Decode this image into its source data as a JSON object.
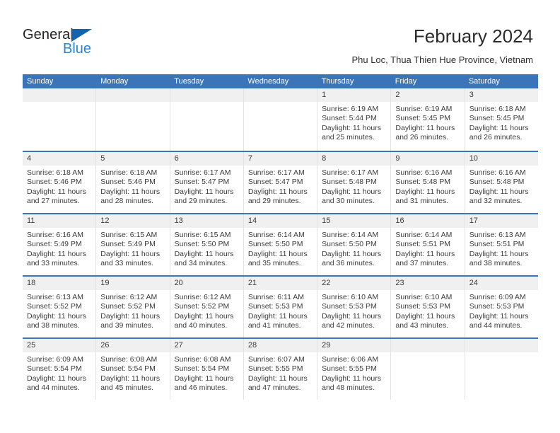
{
  "brand": {
    "name_part1": "General",
    "name_part2": "Blue",
    "triangle_color": "#1562ad",
    "blue_color": "#2786d4"
  },
  "header": {
    "title": "February 2024",
    "subtitle": "Phu Loc, Thua Thien Hue Province, Vietnam"
  },
  "theme": {
    "header_blue": "#3b75b8",
    "row_rule_blue": "#3b75b8",
    "daynum_band": "#f0f0f0",
    "cell_border": "#e2e2e2"
  },
  "calendar": {
    "weekdays": [
      "Sunday",
      "Monday",
      "Tuesday",
      "Wednesday",
      "Thursday",
      "Friday",
      "Saturday"
    ],
    "weeks": [
      [
        {
          "day": "",
          "sunrise": "",
          "sunset": "",
          "daylight": "",
          "empty": true
        },
        {
          "day": "",
          "sunrise": "",
          "sunset": "",
          "daylight": "",
          "empty": true
        },
        {
          "day": "",
          "sunrise": "",
          "sunset": "",
          "daylight": "",
          "empty": true
        },
        {
          "day": "",
          "sunrise": "",
          "sunset": "",
          "daylight": "",
          "empty": true
        },
        {
          "day": "1",
          "sunrise": "Sunrise: 6:19 AM",
          "sunset": "Sunset: 5:44 PM",
          "daylight": "Daylight: 11 hours and 25 minutes."
        },
        {
          "day": "2",
          "sunrise": "Sunrise: 6:19 AM",
          "sunset": "Sunset: 5:45 PM",
          "daylight": "Daylight: 11 hours and 26 minutes."
        },
        {
          "day": "3",
          "sunrise": "Sunrise: 6:18 AM",
          "sunset": "Sunset: 5:45 PM",
          "daylight": "Daylight: 11 hours and 26 minutes."
        }
      ],
      [
        {
          "day": "4",
          "sunrise": "Sunrise: 6:18 AM",
          "sunset": "Sunset: 5:46 PM",
          "daylight": "Daylight: 11 hours and 27 minutes."
        },
        {
          "day": "5",
          "sunrise": "Sunrise: 6:18 AM",
          "sunset": "Sunset: 5:46 PM",
          "daylight": "Daylight: 11 hours and 28 minutes."
        },
        {
          "day": "6",
          "sunrise": "Sunrise: 6:17 AM",
          "sunset": "Sunset: 5:47 PM",
          "daylight": "Daylight: 11 hours and 29 minutes."
        },
        {
          "day": "7",
          "sunrise": "Sunrise: 6:17 AM",
          "sunset": "Sunset: 5:47 PM",
          "daylight": "Daylight: 11 hours and 29 minutes."
        },
        {
          "day": "8",
          "sunrise": "Sunrise: 6:17 AM",
          "sunset": "Sunset: 5:48 PM",
          "daylight": "Daylight: 11 hours and 30 minutes."
        },
        {
          "day": "9",
          "sunrise": "Sunrise: 6:16 AM",
          "sunset": "Sunset: 5:48 PM",
          "daylight": "Daylight: 11 hours and 31 minutes."
        },
        {
          "day": "10",
          "sunrise": "Sunrise: 6:16 AM",
          "sunset": "Sunset: 5:48 PM",
          "daylight": "Daylight: 11 hours and 32 minutes."
        }
      ],
      [
        {
          "day": "11",
          "sunrise": "Sunrise: 6:16 AM",
          "sunset": "Sunset: 5:49 PM",
          "daylight": "Daylight: 11 hours and 33 minutes."
        },
        {
          "day": "12",
          "sunrise": "Sunrise: 6:15 AM",
          "sunset": "Sunset: 5:49 PM",
          "daylight": "Daylight: 11 hours and 33 minutes."
        },
        {
          "day": "13",
          "sunrise": "Sunrise: 6:15 AM",
          "sunset": "Sunset: 5:50 PM",
          "daylight": "Daylight: 11 hours and 34 minutes."
        },
        {
          "day": "14",
          "sunrise": "Sunrise: 6:14 AM",
          "sunset": "Sunset: 5:50 PM",
          "daylight": "Daylight: 11 hours and 35 minutes."
        },
        {
          "day": "15",
          "sunrise": "Sunrise: 6:14 AM",
          "sunset": "Sunset: 5:50 PM",
          "daylight": "Daylight: 11 hours and 36 minutes."
        },
        {
          "day": "16",
          "sunrise": "Sunrise: 6:14 AM",
          "sunset": "Sunset: 5:51 PM",
          "daylight": "Daylight: 11 hours and 37 minutes."
        },
        {
          "day": "17",
          "sunrise": "Sunrise: 6:13 AM",
          "sunset": "Sunset: 5:51 PM",
          "daylight": "Daylight: 11 hours and 38 minutes."
        }
      ],
      [
        {
          "day": "18",
          "sunrise": "Sunrise: 6:13 AM",
          "sunset": "Sunset: 5:52 PM",
          "daylight": "Daylight: 11 hours and 38 minutes."
        },
        {
          "day": "19",
          "sunrise": "Sunrise: 6:12 AM",
          "sunset": "Sunset: 5:52 PM",
          "daylight": "Daylight: 11 hours and 39 minutes."
        },
        {
          "day": "20",
          "sunrise": "Sunrise: 6:12 AM",
          "sunset": "Sunset: 5:52 PM",
          "daylight": "Daylight: 11 hours and 40 minutes."
        },
        {
          "day": "21",
          "sunrise": "Sunrise: 6:11 AM",
          "sunset": "Sunset: 5:53 PM",
          "daylight": "Daylight: 11 hours and 41 minutes."
        },
        {
          "day": "22",
          "sunrise": "Sunrise: 6:10 AM",
          "sunset": "Sunset: 5:53 PM",
          "daylight": "Daylight: 11 hours and 42 minutes."
        },
        {
          "day": "23",
          "sunrise": "Sunrise: 6:10 AM",
          "sunset": "Sunset: 5:53 PM",
          "daylight": "Daylight: 11 hours and 43 minutes."
        },
        {
          "day": "24",
          "sunrise": "Sunrise: 6:09 AM",
          "sunset": "Sunset: 5:53 PM",
          "daylight": "Daylight: 11 hours and 44 minutes."
        }
      ],
      [
        {
          "day": "25",
          "sunrise": "Sunrise: 6:09 AM",
          "sunset": "Sunset: 5:54 PM",
          "daylight": "Daylight: 11 hours and 44 minutes."
        },
        {
          "day": "26",
          "sunrise": "Sunrise: 6:08 AM",
          "sunset": "Sunset: 5:54 PM",
          "daylight": "Daylight: 11 hours and 45 minutes."
        },
        {
          "day": "27",
          "sunrise": "Sunrise: 6:08 AM",
          "sunset": "Sunset: 5:54 PM",
          "daylight": "Daylight: 11 hours and 46 minutes."
        },
        {
          "day": "28",
          "sunrise": "Sunrise: 6:07 AM",
          "sunset": "Sunset: 5:55 PM",
          "daylight": "Daylight: 11 hours and 47 minutes."
        },
        {
          "day": "29",
          "sunrise": "Sunrise: 6:06 AM",
          "sunset": "Sunset: 5:55 PM",
          "daylight": "Daylight: 11 hours and 48 minutes."
        },
        {
          "day": "",
          "sunrise": "",
          "sunset": "",
          "daylight": "",
          "empty": true
        },
        {
          "day": "",
          "sunrise": "",
          "sunset": "",
          "daylight": "",
          "empty": true
        }
      ]
    ]
  }
}
